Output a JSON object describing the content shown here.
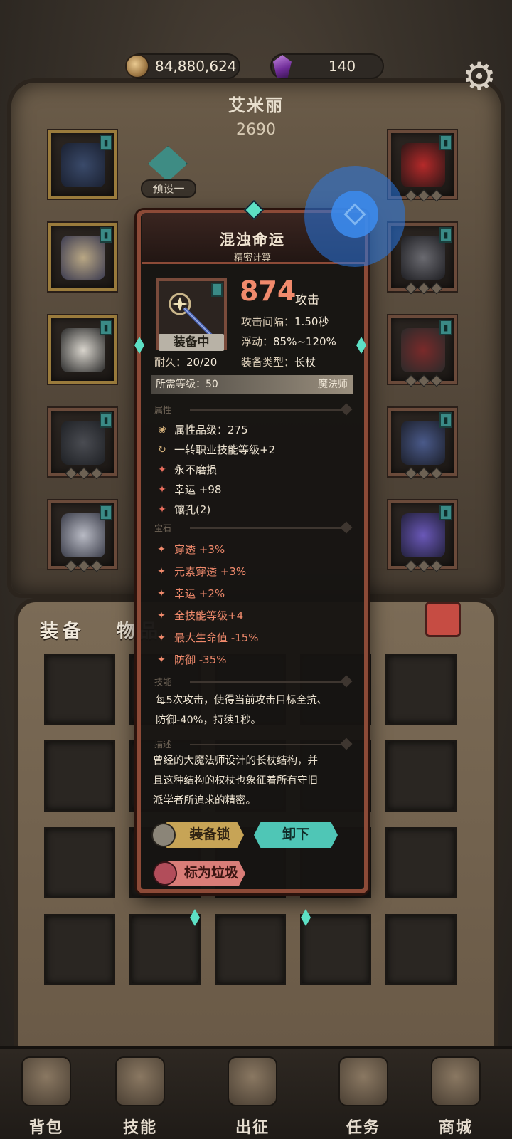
{
  "currency": {
    "gold_icon": "coin-icon",
    "gold": "84,880,624",
    "gem_icon": "purple-gem-icon",
    "gems": "140"
  },
  "settings_icon": "gear-icon",
  "character": {
    "name": "艾米丽",
    "power": "2690",
    "preset": "预设一"
  },
  "tooltip": {
    "name": "混浊命运",
    "subtitle": "精密计算",
    "equipped": "装备中",
    "attack_value": "874",
    "attack_label": "攻击",
    "attack_interval_label": "攻击间隔：",
    "attack_interval": "1.50秒",
    "float_label": "浮动：",
    "float": "85%~120%",
    "durability_label": "耐久：",
    "durability": "20/20",
    "type_label": "装备类型：",
    "type": "长杖",
    "req_level": "所需等级：50",
    "req_class": "魔法师",
    "sections": {
      "attributes": "属性",
      "gems": "宝石",
      "skill": "技能",
      "description": "描述"
    },
    "attributes": [
      "属性品级：275",
      "一转职业技能等级+2",
      "永不磨损",
      "幸运 +98",
      "镶孔(2)"
    ],
    "gem_stats": [
      "穿透 +3%",
      "元素穿透 +3%",
      "幸运 +2%",
      "全技能等级+4",
      "最大生命值 -15%",
      "防御 -35%"
    ],
    "skill_text_1": "每5次攻击，使得当前攻击目标全抗、",
    "skill_text_2": "防御-40%，持续1秒。",
    "desc_1": "曾经的大魔法师设计的长杖结构，并",
    "desc_2": "且这种结构的权杖也象征着所有守旧",
    "desc_3": "派学者所追求的精密。",
    "btn_lock": "装备锁",
    "btn_unequip": "卸下",
    "btn_junk": "标为垃圾"
  },
  "bag": {
    "tab_equip": "装备",
    "tab_items": "物品"
  },
  "nav": [
    {
      "label": "背包",
      "icon": "backpack-icon"
    },
    {
      "label": "技能",
      "icon": "skill-book-icon"
    },
    {
      "label": "出征",
      "icon": "map-scroll-icon"
    },
    {
      "label": "任务",
      "icon": "quest-scroll-icon"
    },
    {
      "label": "商城",
      "icon": "shop-crown-icon"
    }
  ],
  "colors": {
    "attack": "#f08a6c",
    "accent_teal": "#4fc6b6",
    "gold_button": "#c7a456",
    "junk_button": "#d97d78",
    "frame": "#8c4a37"
  }
}
